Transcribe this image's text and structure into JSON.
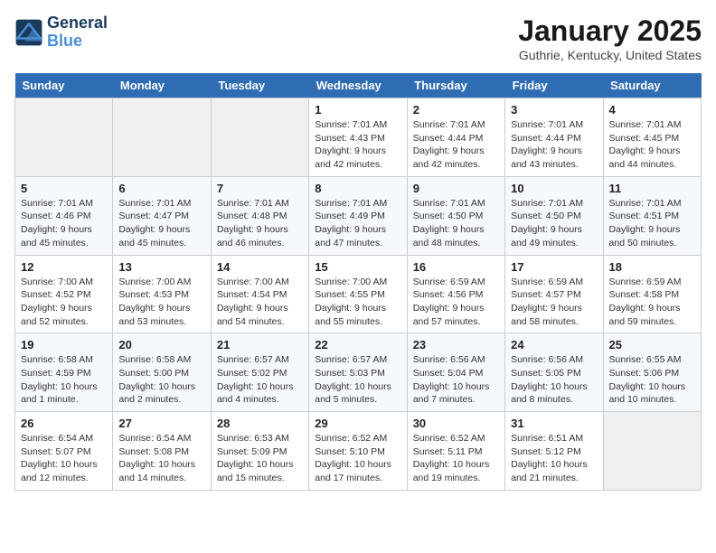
{
  "header": {
    "logo_line1": "General",
    "logo_line2": "Blue",
    "month": "January 2025",
    "location": "Guthrie, Kentucky, United States"
  },
  "weekdays": [
    "Sunday",
    "Monday",
    "Tuesday",
    "Wednesday",
    "Thursday",
    "Friday",
    "Saturday"
  ],
  "weeks": [
    [
      {
        "day": "",
        "empty": true
      },
      {
        "day": "",
        "empty": true
      },
      {
        "day": "",
        "empty": true
      },
      {
        "day": "1",
        "sunrise": "7:01 AM",
        "sunset": "4:43 PM",
        "daylight": "9 hours and 42 minutes."
      },
      {
        "day": "2",
        "sunrise": "7:01 AM",
        "sunset": "4:44 PM",
        "daylight": "9 hours and 42 minutes."
      },
      {
        "day": "3",
        "sunrise": "7:01 AM",
        "sunset": "4:44 PM",
        "daylight": "9 hours and 43 minutes."
      },
      {
        "day": "4",
        "sunrise": "7:01 AM",
        "sunset": "4:45 PM",
        "daylight": "9 hours and 44 minutes."
      }
    ],
    [
      {
        "day": "5",
        "sunrise": "7:01 AM",
        "sunset": "4:46 PM",
        "daylight": "9 hours and 45 minutes."
      },
      {
        "day": "6",
        "sunrise": "7:01 AM",
        "sunset": "4:47 PM",
        "daylight": "9 hours and 45 minutes."
      },
      {
        "day": "7",
        "sunrise": "7:01 AM",
        "sunset": "4:48 PM",
        "daylight": "9 hours and 46 minutes."
      },
      {
        "day": "8",
        "sunrise": "7:01 AM",
        "sunset": "4:49 PM",
        "daylight": "9 hours and 47 minutes."
      },
      {
        "day": "9",
        "sunrise": "7:01 AM",
        "sunset": "4:50 PM",
        "daylight": "9 hours and 48 minutes."
      },
      {
        "day": "10",
        "sunrise": "7:01 AM",
        "sunset": "4:50 PM",
        "daylight": "9 hours and 49 minutes."
      },
      {
        "day": "11",
        "sunrise": "7:01 AM",
        "sunset": "4:51 PM",
        "daylight": "9 hours and 50 minutes."
      }
    ],
    [
      {
        "day": "12",
        "sunrise": "7:00 AM",
        "sunset": "4:52 PM",
        "daylight": "9 hours and 52 minutes."
      },
      {
        "day": "13",
        "sunrise": "7:00 AM",
        "sunset": "4:53 PM",
        "daylight": "9 hours and 53 minutes."
      },
      {
        "day": "14",
        "sunrise": "7:00 AM",
        "sunset": "4:54 PM",
        "daylight": "9 hours and 54 minutes."
      },
      {
        "day": "15",
        "sunrise": "7:00 AM",
        "sunset": "4:55 PM",
        "daylight": "9 hours and 55 minutes."
      },
      {
        "day": "16",
        "sunrise": "6:59 AM",
        "sunset": "4:56 PM",
        "daylight": "9 hours and 57 minutes."
      },
      {
        "day": "17",
        "sunrise": "6:59 AM",
        "sunset": "4:57 PM",
        "daylight": "9 hours and 58 minutes."
      },
      {
        "day": "18",
        "sunrise": "6:59 AM",
        "sunset": "4:58 PM",
        "daylight": "9 hours and 59 minutes."
      }
    ],
    [
      {
        "day": "19",
        "sunrise": "6:58 AM",
        "sunset": "4:59 PM",
        "daylight": "10 hours and 1 minute."
      },
      {
        "day": "20",
        "sunrise": "6:58 AM",
        "sunset": "5:00 PM",
        "daylight": "10 hours and 2 minutes."
      },
      {
        "day": "21",
        "sunrise": "6:57 AM",
        "sunset": "5:02 PM",
        "daylight": "10 hours and 4 minutes."
      },
      {
        "day": "22",
        "sunrise": "6:57 AM",
        "sunset": "5:03 PM",
        "daylight": "10 hours and 5 minutes."
      },
      {
        "day": "23",
        "sunrise": "6:56 AM",
        "sunset": "5:04 PM",
        "daylight": "10 hours and 7 minutes."
      },
      {
        "day": "24",
        "sunrise": "6:56 AM",
        "sunset": "5:05 PM",
        "daylight": "10 hours and 8 minutes."
      },
      {
        "day": "25",
        "sunrise": "6:55 AM",
        "sunset": "5:06 PM",
        "daylight": "10 hours and 10 minutes."
      }
    ],
    [
      {
        "day": "26",
        "sunrise": "6:54 AM",
        "sunset": "5:07 PM",
        "daylight": "10 hours and 12 minutes."
      },
      {
        "day": "27",
        "sunrise": "6:54 AM",
        "sunset": "5:08 PM",
        "daylight": "10 hours and 14 minutes."
      },
      {
        "day": "28",
        "sunrise": "6:53 AM",
        "sunset": "5:09 PM",
        "daylight": "10 hours and 15 minutes."
      },
      {
        "day": "29",
        "sunrise": "6:52 AM",
        "sunset": "5:10 PM",
        "daylight": "10 hours and 17 minutes."
      },
      {
        "day": "30",
        "sunrise": "6:52 AM",
        "sunset": "5:11 PM",
        "daylight": "10 hours and 19 minutes."
      },
      {
        "day": "31",
        "sunrise": "6:51 AM",
        "sunset": "5:12 PM",
        "daylight": "10 hours and 21 minutes."
      },
      {
        "day": "",
        "empty": true
      }
    ]
  ]
}
